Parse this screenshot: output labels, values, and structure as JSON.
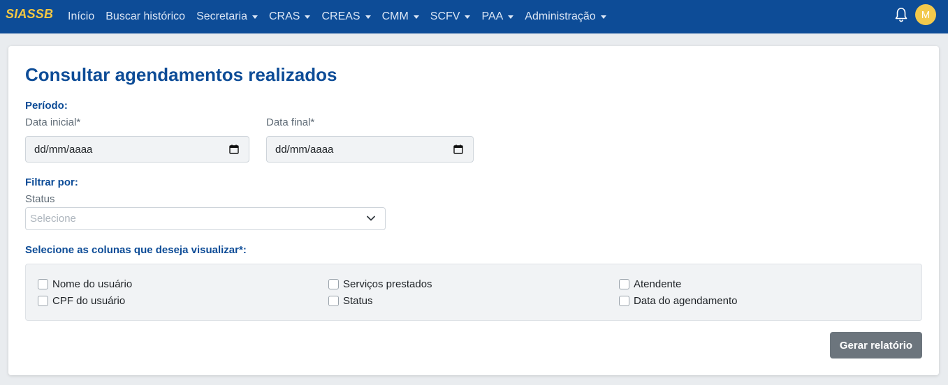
{
  "navbar": {
    "brand": "SIASSB",
    "items": [
      {
        "label": "Início",
        "dropdown": false
      },
      {
        "label": "Buscar histórico",
        "dropdown": false
      },
      {
        "label": "Secretaria",
        "dropdown": true
      },
      {
        "label": "CRAS",
        "dropdown": true
      },
      {
        "label": "CREAS",
        "dropdown": true
      },
      {
        "label": "CMM",
        "dropdown": true
      },
      {
        "label": "SCFV",
        "dropdown": true
      },
      {
        "label": "PAA",
        "dropdown": true
      },
      {
        "label": "Administração",
        "dropdown": true
      }
    ],
    "notification_icon": "bell-icon",
    "avatar_initial": "M",
    "colors": {
      "navbar_bg": "#0d4c97",
      "brand": "#f5c842",
      "avatar": "#f2c94c"
    }
  },
  "form": {
    "title": "Consultar agendamentos realizados",
    "period_label": "Período:",
    "start_date_label": "Data inicial*",
    "start_date_value": "dd/mm/aaaa",
    "end_date_label": "Data final*",
    "end_date_value": "dd/mm/aaaa",
    "filter_label": "Filtrar por:",
    "status_label": "Status",
    "status_placeholder": "Selecione",
    "columns_label": "Selecione as colunas que deseja visualizar*:",
    "columns": [
      {
        "label": "Nome do usuário",
        "checked": false
      },
      {
        "label": "CPF do usuário",
        "checked": false
      },
      {
        "label": "Serviços prestados",
        "checked": false
      },
      {
        "label": "Status",
        "checked": false
      },
      {
        "label": "Atendente",
        "checked": false
      },
      {
        "label": "Data do agendamento",
        "checked": false
      }
    ],
    "submit_label": "Gerar relatório"
  }
}
